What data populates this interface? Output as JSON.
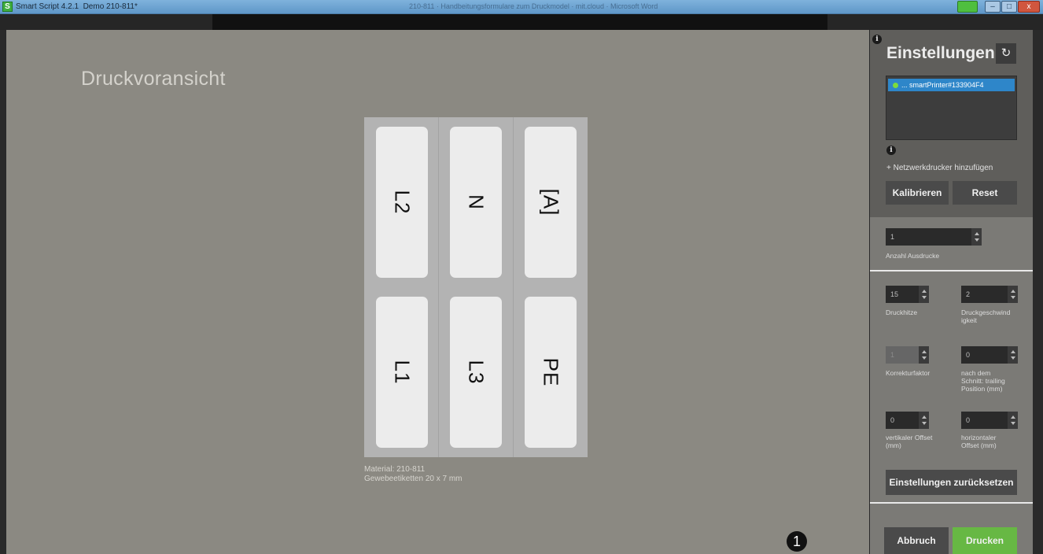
{
  "window": {
    "app_title": "Smart Script 4.2.1  Demo 210-811*",
    "center_title": "210-811 · Handbeitungsformulare zum Druckmodel · mit.cloud · Microsoft Word",
    "min_symbol": "–",
    "max_symbol": "□",
    "close_symbol": "x"
  },
  "preview": {
    "title": "Druckvoransicht",
    "labels": [
      "L2",
      "N",
      "[A]",
      "L1",
      "L3",
      "PE"
    ],
    "material_line1": "Material: 210-811",
    "material_line2": "Gewebeetiketten  20 x 7 mm"
  },
  "settings": {
    "title": "Einstellungen",
    "refresh_icon": "↻",
    "printer": "... smartPrinter#133904F4",
    "add_printer": "+ Netzwerkdrucker hinzufügen",
    "calibrate": "Kalibrieren",
    "reset": "Reset",
    "copies": {
      "value": "1",
      "label": "Anzahl Ausdrucke"
    },
    "heat": {
      "value": "15",
      "label": "Druckhitze"
    },
    "speed": {
      "value": "2",
      "label_line1": "Druckgeschwind",
      "label_line2": "igkeit"
    },
    "correction": {
      "value": "1",
      "label": "Korrekturfaktor"
    },
    "cut": {
      "value": "0",
      "label_line1": "nach dem",
      "label_line2": "Schnitt: trailing",
      "label_line3": "Position (mm)"
    },
    "vert_offset": {
      "value": "0",
      "label_line1": "vertikaler Offset",
      "label_line2": "(mm)"
    },
    "horiz_offset": {
      "value": "0",
      "label_line1": "horizontaler",
      "label_line2": "Offset (mm)"
    },
    "reset_settings": "Einstellungen zurücksetzen",
    "cancel": "Abbruch",
    "print": "Drucken",
    "callout": "1"
  },
  "colors": {
    "print_button": "#67b844",
    "printer_selected": "#2e86c9",
    "status_online": "#7cdc3c"
  }
}
